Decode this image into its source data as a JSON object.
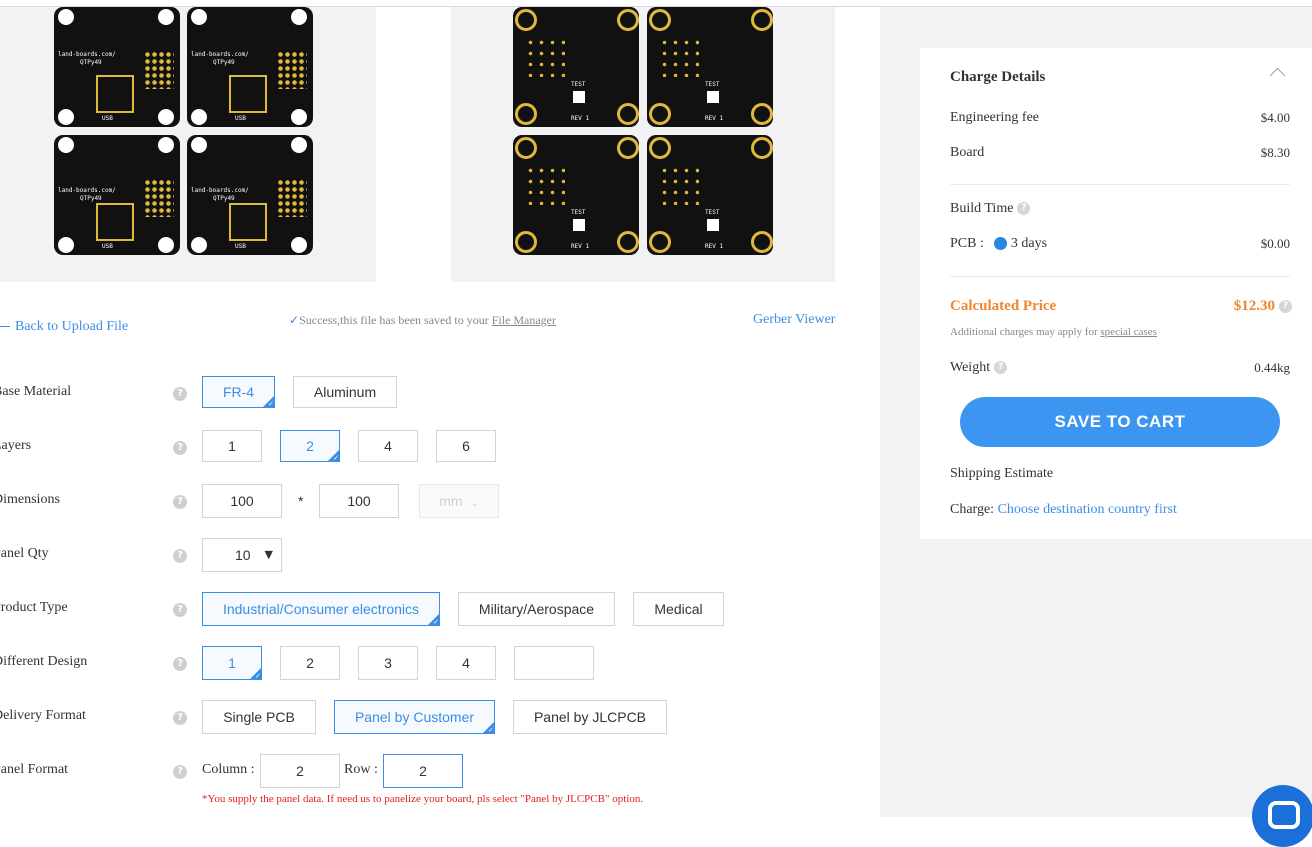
{
  "links": {
    "back": "Back to Upload File",
    "success_prefix": "Success,this file has been saved to your ",
    "file_manager": "File Manager",
    "gerber_viewer": "Gerber Viewer"
  },
  "board_text": {
    "url": "land-boards.com/",
    "name": "QTPy49",
    "usb": "USB",
    "rev": "REV 1",
    "test": "TEST"
  },
  "form": {
    "base_material": {
      "label": "Base Material",
      "options": [
        "FR-4",
        "Aluminum"
      ],
      "selected": "FR-4"
    },
    "layers": {
      "label": "Layers",
      "options": [
        "1",
        "2",
        "4",
        "6"
      ],
      "selected": "2"
    },
    "dimensions": {
      "label": "Dimensions",
      "width": "100",
      "separator": "*",
      "height": "100",
      "unit": "mm"
    },
    "panel_qty": {
      "label": "Panel Qty",
      "value": "10"
    },
    "product_type": {
      "label": "Product Type",
      "options": [
        "Industrial/Consumer electronics",
        "Military/Aerospace",
        "Medical"
      ],
      "selected": "Industrial/Consumer electronics"
    },
    "different_design": {
      "label": "Different Design",
      "options": [
        "1",
        "2",
        "3",
        "4"
      ],
      "custom_value": "",
      "selected": "1"
    },
    "delivery_format": {
      "label": "Delivery Format",
      "options": [
        "Single PCB",
        "Panel by Customer",
        "Panel by JLCPCB"
      ],
      "selected": "Panel by Customer"
    },
    "panel_format": {
      "label": "Panel Format",
      "column_label": "Column :",
      "column_value": "2",
      "row_label": "Row :",
      "row_value": "2",
      "note": "*You supply the panel data. If need us to panelize your board, pls select \"Panel by JLCPCB\" option."
    }
  },
  "charges": {
    "title": "Charge Details",
    "engineering_fee_label": "Engineering fee",
    "engineering_fee": "$4.00",
    "board_label": "Board",
    "board": "$8.30",
    "build_time_label": "Build Time",
    "pcb_label": "PCB :",
    "pcb_days": "3 days",
    "pcb_cost": "$0.00",
    "calculated_label": "Calculated Price",
    "calculated": "$12.30",
    "additional_prefix": "Additional charges may apply for ",
    "special_cases": "special cases",
    "weight_label": "Weight",
    "weight": "0.44kg",
    "save_to_cart": "SAVE TO CART",
    "shipping_label": "Shipping Estimate",
    "charge_label": "Charge: ",
    "charge_link": "Choose destination country first"
  },
  "colors": {
    "accent": "#3a8ee6",
    "price": "#f0862f",
    "button": "#3d95f2",
    "note": "#e02020"
  }
}
